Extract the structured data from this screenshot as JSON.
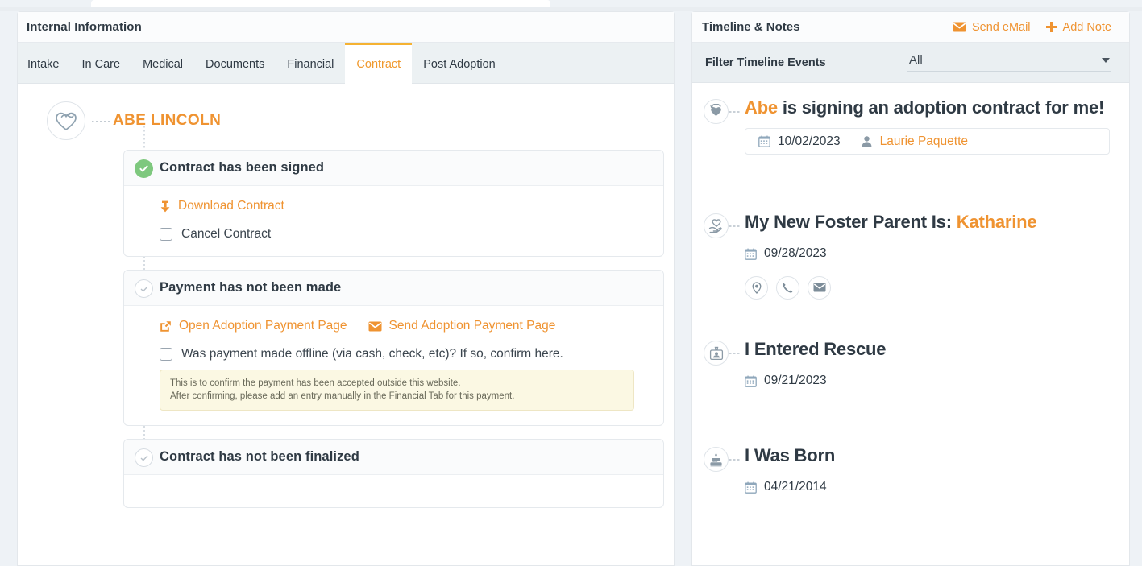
{
  "left_panel": {
    "header_title": "Internal Information",
    "tabs": [
      {
        "label": "Intake",
        "active": false
      },
      {
        "label": "In Care",
        "active": false
      },
      {
        "label": "Medical",
        "active": false
      },
      {
        "label": "Documents",
        "active": false
      },
      {
        "label": "Financial",
        "active": false
      },
      {
        "label": "Contract",
        "active": true
      },
      {
        "label": "Post Adoption",
        "active": false
      }
    ],
    "pet": {
      "name": "ABE LINCOLN",
      "avatar_icon": "heart-infinity-logo-icon"
    },
    "steps": [
      {
        "title": "Contract has been signed",
        "state": "done",
        "links": [
          {
            "label": "Download Contract",
            "icon": "download-icon"
          }
        ],
        "checkbox": {
          "label": "Cancel Contract",
          "checked": false
        },
        "note": null
      },
      {
        "title": "Payment has not been made",
        "state": "pending",
        "links": [
          {
            "label": "Open Adoption Payment Page",
            "icon": "external-link-icon"
          },
          {
            "label": "Send Adoption Payment Page",
            "icon": "envelope-icon"
          }
        ],
        "checkbox": {
          "label": "Was payment made offline (via cash, check, etc)? If so, confirm here.",
          "checked": false
        },
        "note": {
          "line1": "This is to confirm the payment has been accepted outside this website.",
          "line2": "After confirming, please add an entry manually in the Financial Tab for this payment."
        }
      },
      {
        "title": "Contract has not been finalized",
        "state": "pending",
        "links": [],
        "checkbox": null,
        "note": null
      }
    ]
  },
  "right_panel": {
    "header_title": "Timeline & Notes",
    "actions": [
      {
        "label": "Send eMail",
        "icon": "envelope-icon"
      },
      {
        "label": "Add Note",
        "icon": "plus-icon"
      }
    ],
    "filter": {
      "label": "Filter Timeline Events",
      "value": "All",
      "caret_icon": "chevron-down-icon"
    },
    "events": [
      {
        "icon": "heart-refresh-icon",
        "title_prefix": "Abe",
        "title_rest": " is signing an adoption contract for me!",
        "date": "10/02/2023",
        "person": "Laurie Paquette",
        "boxed": true,
        "contacts": []
      },
      {
        "icon": "heart-in-hand-icon",
        "title_prefix": "My New Foster Parent Is: ",
        "title_rest": "Katharine",
        "highlight_rest": true,
        "date": "09/28/2023",
        "person": null,
        "boxed": false,
        "contacts": [
          "location-pin-icon",
          "phone-icon",
          "envelope-icon"
        ]
      },
      {
        "icon": "id-badge-icon",
        "title_prefix": "I Entered Rescue",
        "title_rest": "",
        "date": "09/21/2023",
        "person": null,
        "boxed": false,
        "contacts": []
      },
      {
        "icon": "birthday-cake-icon",
        "title_prefix": "I Was Born",
        "title_rest": "",
        "date": "04/21/2014",
        "person": null,
        "boxed": false,
        "contacts": []
      }
    ]
  },
  "colors": {
    "accent_orange": "#ef9331",
    "tab_underline": "#f5b233",
    "done_green": "#7ec87e",
    "text_dark": "#2f3a44",
    "panel_bg": "#ffffff",
    "app_bg": "#eef2f6",
    "note_bg": "#fbf8e3",
    "filter_bg": "#eaeff2",
    "icon_gray": "#8b9aa6"
  }
}
